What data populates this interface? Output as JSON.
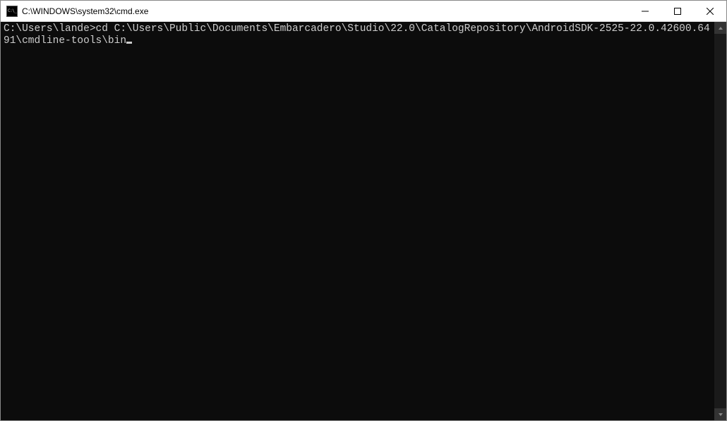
{
  "window": {
    "title": "C:\\WINDOWS\\system32\\cmd.exe"
  },
  "terminal": {
    "prompt": "C:\\Users\\lande>",
    "command": "cd C:\\Users\\Public\\Documents\\Embarcadero\\Studio\\22.0\\CatalogRepository\\AndroidSDK-2525-22.0.42600.6491\\cmdline-tools\\bin"
  }
}
